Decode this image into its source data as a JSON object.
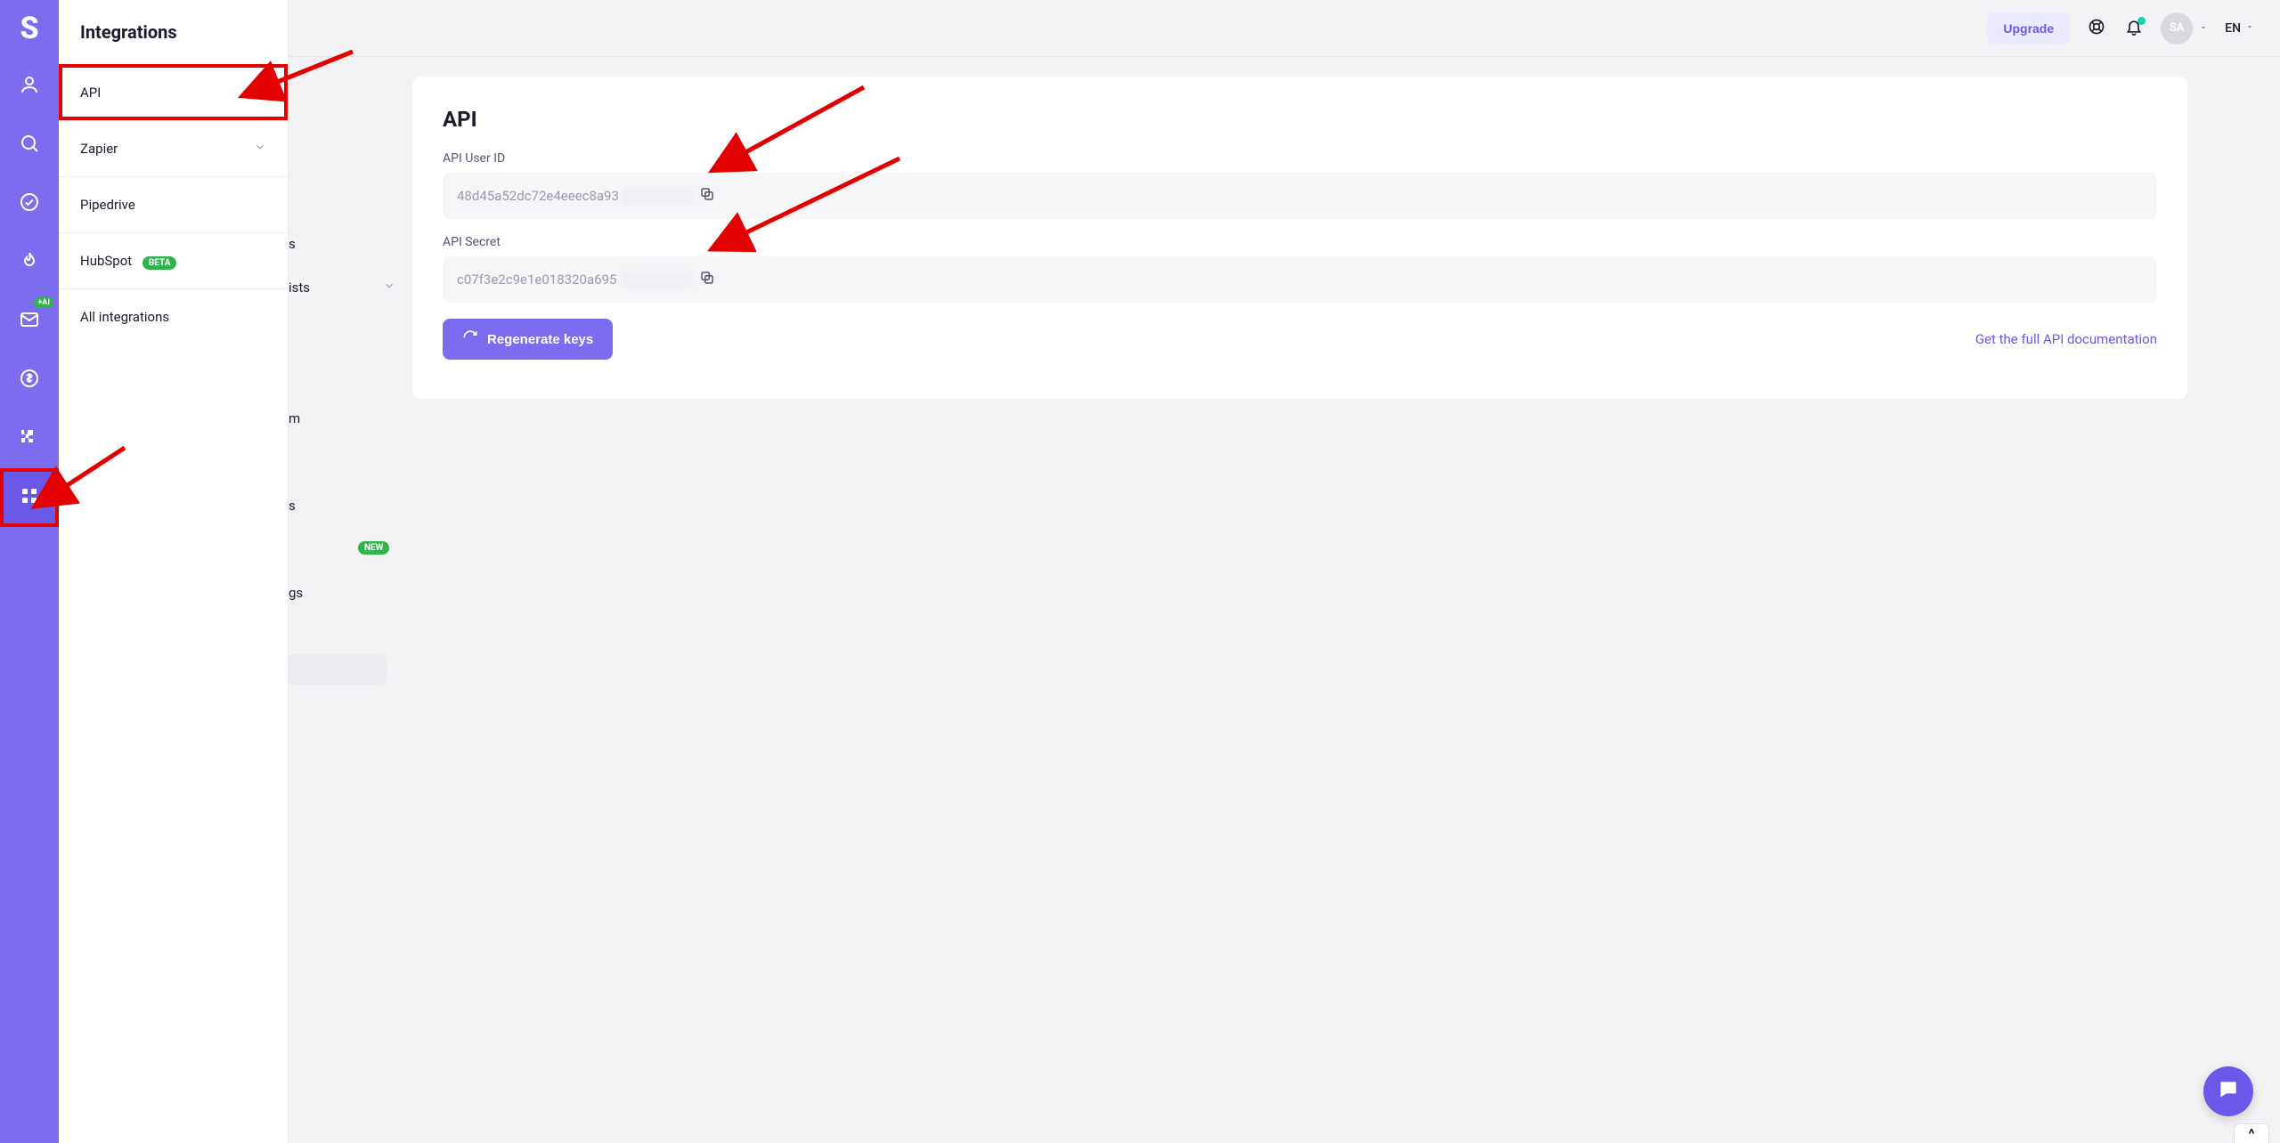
{
  "brand_letter": "S",
  "topbar": {
    "upgrade": "Upgrade",
    "avatar_initials": "SA",
    "lang": "EN"
  },
  "rail_ai_badge": "+AI",
  "submenu": {
    "title": "Integrations",
    "items": [
      {
        "label": "API"
      },
      {
        "label": "Zapier"
      },
      {
        "label": "Pipedrive"
      },
      {
        "label": "HubSpot",
        "beta": "BETA"
      },
      {
        "label": "All integrations"
      }
    ]
  },
  "under_peek": {
    "r1": "s",
    "r2": "ists",
    "r3": "m",
    "r4": "s",
    "r5_badge": "NEW",
    "r6": "gs"
  },
  "api": {
    "heading": "API",
    "user_id_label": "API User ID",
    "user_id_value": "48d45a52dc72e4eeec8a93",
    "secret_label": "API Secret",
    "secret_value": "c07f3e2c9e1e018320a695",
    "regenerate": "Regenerate keys",
    "doc_link": "Get the full API documentation"
  }
}
